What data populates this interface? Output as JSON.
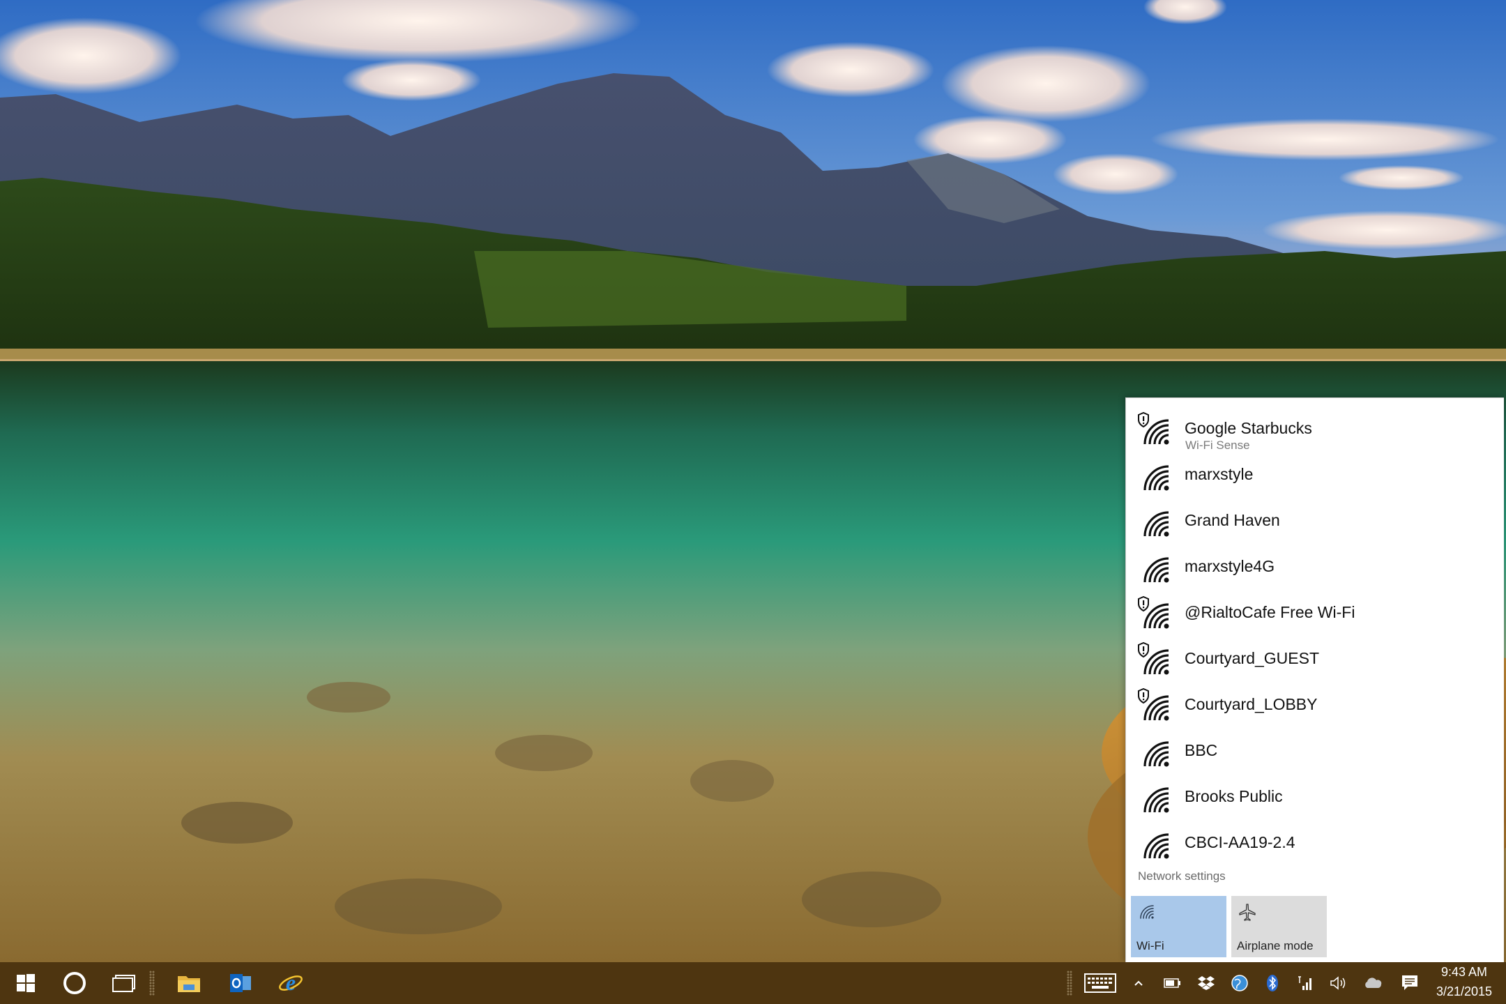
{
  "networks": [
    {
      "name": "Google Starbucks",
      "subtitle": "Wi-Fi Sense",
      "secured_shield": true
    },
    {
      "name": "marxstyle",
      "subtitle": "",
      "secured_shield": false
    },
    {
      "name": "Grand Haven",
      "subtitle": "",
      "secured_shield": false
    },
    {
      "name": "marxstyle4G",
      "subtitle": "",
      "secured_shield": false
    },
    {
      "name": "@RialtoCafe Free Wi-Fi",
      "subtitle": "",
      "secured_shield": true
    },
    {
      "name": "Courtyard_GUEST",
      "subtitle": "",
      "secured_shield": true
    },
    {
      "name": "Courtyard_LOBBY",
      "subtitle": "",
      "secured_shield": true
    },
    {
      "name": "BBC",
      "subtitle": "",
      "secured_shield": false
    },
    {
      "name": "Brooks Public",
      "subtitle": "",
      "secured_shield": false
    },
    {
      "name": "CBCI-AA19-2.4",
      "subtitle": "",
      "secured_shield": false
    }
  ],
  "flyout": {
    "network_settings_label": "Network settings",
    "quick_actions": [
      {
        "label": "Wi-Fi",
        "icon": "wifi-icon",
        "active": true
      },
      {
        "label": "Airplane mode",
        "icon": "airplane-icon",
        "active": false
      }
    ]
  },
  "taskbar": {
    "pinned": [
      {
        "name": "start-button",
        "icon": "windows-logo-icon"
      },
      {
        "name": "cortana-button",
        "icon": "cortana-circle-icon"
      },
      {
        "name": "task-view-button",
        "icon": "task-view-icon"
      },
      {
        "name": "file-explorer-button",
        "icon": "folder-icon"
      },
      {
        "name": "outlook-button",
        "icon": "outlook-icon"
      },
      {
        "name": "internet-explorer-button",
        "icon": "internet-explorer-icon"
      }
    ],
    "tray_icons": [
      "keyboard-icon",
      "chevron-up-icon",
      "battery-icon",
      "dropbox-icon",
      "globe-icon",
      "bluetooth-icon",
      "cellular-signal-icon",
      "volume-icon",
      "onedrive-cloud-icon",
      "action-center-icon"
    ],
    "time": "9:43 AM",
    "date": "3/21/2015"
  },
  "colors": {
    "taskbar": "#4e3510",
    "wifi_tile_active": "#a9c8ea",
    "tile_inactive": "#dcdcdc",
    "flyout_bg": "#ffffff"
  }
}
